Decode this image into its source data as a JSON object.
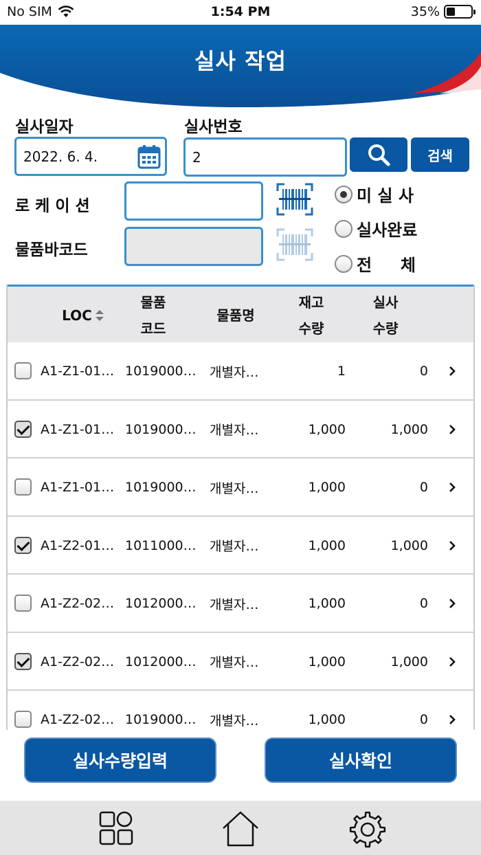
{
  "status": {
    "carrier": "No SIM",
    "time": "1:54 PM",
    "battery": "35%"
  },
  "header": {
    "title": "실사 작업"
  },
  "form": {
    "date_label": "실사일자",
    "date_value": "2022. 6. 4.",
    "number_label": "실사번호",
    "number_value": "2",
    "search_label": "검색",
    "location_label": "로 케 이 션",
    "location_value": "",
    "barcode_label": "물품바코드",
    "barcode_value": ""
  },
  "filters": [
    {
      "label": "미 실 사",
      "checked": true
    },
    {
      "label": "실사완료",
      "checked": false
    },
    {
      "label": "전     체",
      "checked": false
    }
  ],
  "table": {
    "headers": {
      "loc": "LOC",
      "code_1": "물품",
      "code_2": "코드",
      "name": "물품명",
      "stock_1": "재고",
      "stock_2": "수량",
      "actual_1": "실사",
      "actual_2": "수량"
    },
    "rows": [
      {
        "checked": false,
        "loc": "A1-Z1-01…",
        "code": "1019000…",
        "name": "개별자…",
        "stock": "1",
        "actual": "0"
      },
      {
        "checked": true,
        "loc": "A1-Z1-01…",
        "code": "1019000…",
        "name": "개별자…",
        "stock": "1,000",
        "actual": "1,000"
      },
      {
        "checked": false,
        "loc": "A1-Z1-01…",
        "code": "1019000…",
        "name": "개별자…",
        "stock": "1,000",
        "actual": "0"
      },
      {
        "checked": true,
        "loc": "A1-Z2-01…",
        "code": "1011000…",
        "name": "개별자…",
        "stock": "1,000",
        "actual": "1,000"
      },
      {
        "checked": false,
        "loc": "A1-Z2-02…",
        "code": "1012000…",
        "name": "개별자…",
        "stock": "1,000",
        "actual": "0"
      },
      {
        "checked": true,
        "loc": "A1-Z2-02…",
        "code": "1012000…",
        "name": "개별자…",
        "stock": "1,000",
        "actual": "1,000"
      },
      {
        "checked": false,
        "loc": "A1-Z2-02…",
        "code": "1019000…",
        "name": "개별자…",
        "stock": "1,000",
        "actual": "0"
      }
    ]
  },
  "actions": {
    "input_qty": "실사수량입력",
    "confirm": "실사확인"
  },
  "tabbar": {
    "icons": [
      "grid-icon",
      "home-icon",
      "gear-icon"
    ]
  },
  "colors": {
    "primary": "#0a57a3",
    "field_border": "#3b8fcb",
    "accent_red": "#d8202a"
  }
}
